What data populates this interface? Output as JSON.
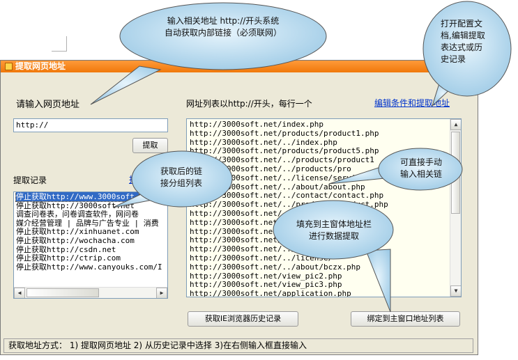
{
  "callouts": {
    "top": [
      "输入相关地址 http://开头系统",
      "自动获取内部链接（必须联网）"
    ],
    "top_right": [
      "打开配置文",
      "档,编辑提取",
      "表达式或历",
      "史记录"
    ],
    "middle_left": [
      "获取后的链",
      "接分组列表"
    ],
    "middle_right": [
      "可直接手动",
      "输入相关链"
    ],
    "bottom_right": [
      "填充到主窗体地址栏",
      "进行数据提取"
    ]
  },
  "window": {
    "title": "提取网页地址",
    "url_label": "请输入网页地址",
    "url_input_value": "http://",
    "extract_button": "提取",
    "history_label": "提取记录",
    "history_link": "打",
    "history_items": [
      "停止获取http://www.3000soft.",
      "停止获取http://3000soft.net",
      "调查问卷表，问卷调查软件，网问卷",
      "媒介经营管理 | 品牌与广告专业 | 消费",
      "停止获取http://xinhuanet.com",
      "停止获取http://wochacha.com",
      "停止获取http://csdn.net",
      "停止获取http://ctrip.com",
      "停止获取http://www.canyouks.com/I"
    ],
    "list_label": "网址列表以http://开头，每行一个",
    "edit_link": "编辑条件和提取地址",
    "url_list": [
      "http://3000soft.net/index.php",
      "http://3000soft.net/products/product1.php",
      "http://3000soft.net/../index.php",
      "http://3000soft.net/products/product5.php",
      "http://3000soft.net/../products/product1",
      "http://3000soft.net/../products/pro",
      "http://3000soft.net/../license/services",
      "http://3000soft.net/../about/about.php",
      "http://3000soft.net/../contact/contact.php",
      "http://3000soft.net/../products/product.php",
      "http://3000soft.net/../license/",
      "http://3000soft.net/../lic",
      "http://3000soft.net/../l",
      "http://3000soft.net/../",
      "http://3000soft.net/../lic",
      "http://3000soft.net/../license/",
      "http://3000soft.net/../about/bczx.php",
      "http://3000soft.net/view_pic2.php",
      "http://3000soft.net/view_pic3.php",
      "http://3000soft.net/application.php"
    ],
    "ie_history_button": "获取IE浏览器历史记录",
    "bind_button": "绑定到主窗口地址列表",
    "status": "获取地址方式： 1) 提取网页地址 2) 从历史记录中选择 3)在右侧输入框直接输入"
  },
  "colors": {
    "titlebar": "#f0780a",
    "callout_fill": "#b9dcf0",
    "link": "#0033cc",
    "selection": "#316ac5",
    "url_list_bg": "#fffff0"
  }
}
